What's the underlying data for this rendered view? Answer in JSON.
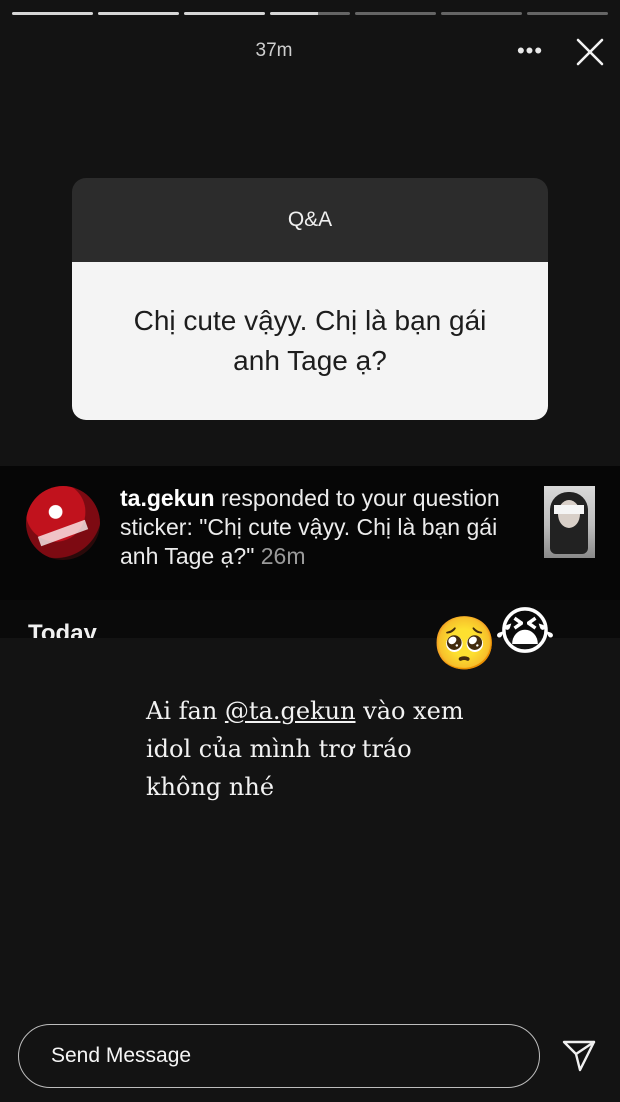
{
  "story": {
    "progress_segments": [
      {
        "state": "done"
      },
      {
        "state": "done"
      },
      {
        "state": "done"
      },
      {
        "state": "partial",
        "fraction": 0.6
      },
      {
        "state": "empty"
      },
      {
        "state": "empty"
      },
      {
        "state": "empty"
      }
    ],
    "time_ago": "37m",
    "more_label": "•••",
    "icons": {
      "close": "close-icon",
      "more": "more-icon",
      "send": "send-icon"
    }
  },
  "qa": {
    "title": "Q&A",
    "question": "Chị cute vậyy. Chị là bạn gái anh Tage ạ?"
  },
  "notification": {
    "username": "ta.gekun",
    "text": " responded to your question sticker: \"Chị cute vậyy. Chị là bạn gái anh Tage ạ?\" ",
    "time": "26m"
  },
  "today_label": "Today",
  "emojis": [
    "🥺",
    "😭"
  ],
  "caption": {
    "prefix": "Ai fan ",
    "mention": "@ta.gekun",
    "suffix": " vào xem idol của mình trơ tráo không nhé"
  },
  "message_input": {
    "placeholder": "Send Message"
  },
  "colors": {
    "background": "#131313",
    "card_header": "#2c2c2c",
    "card_body": "#f4f4f4"
  }
}
